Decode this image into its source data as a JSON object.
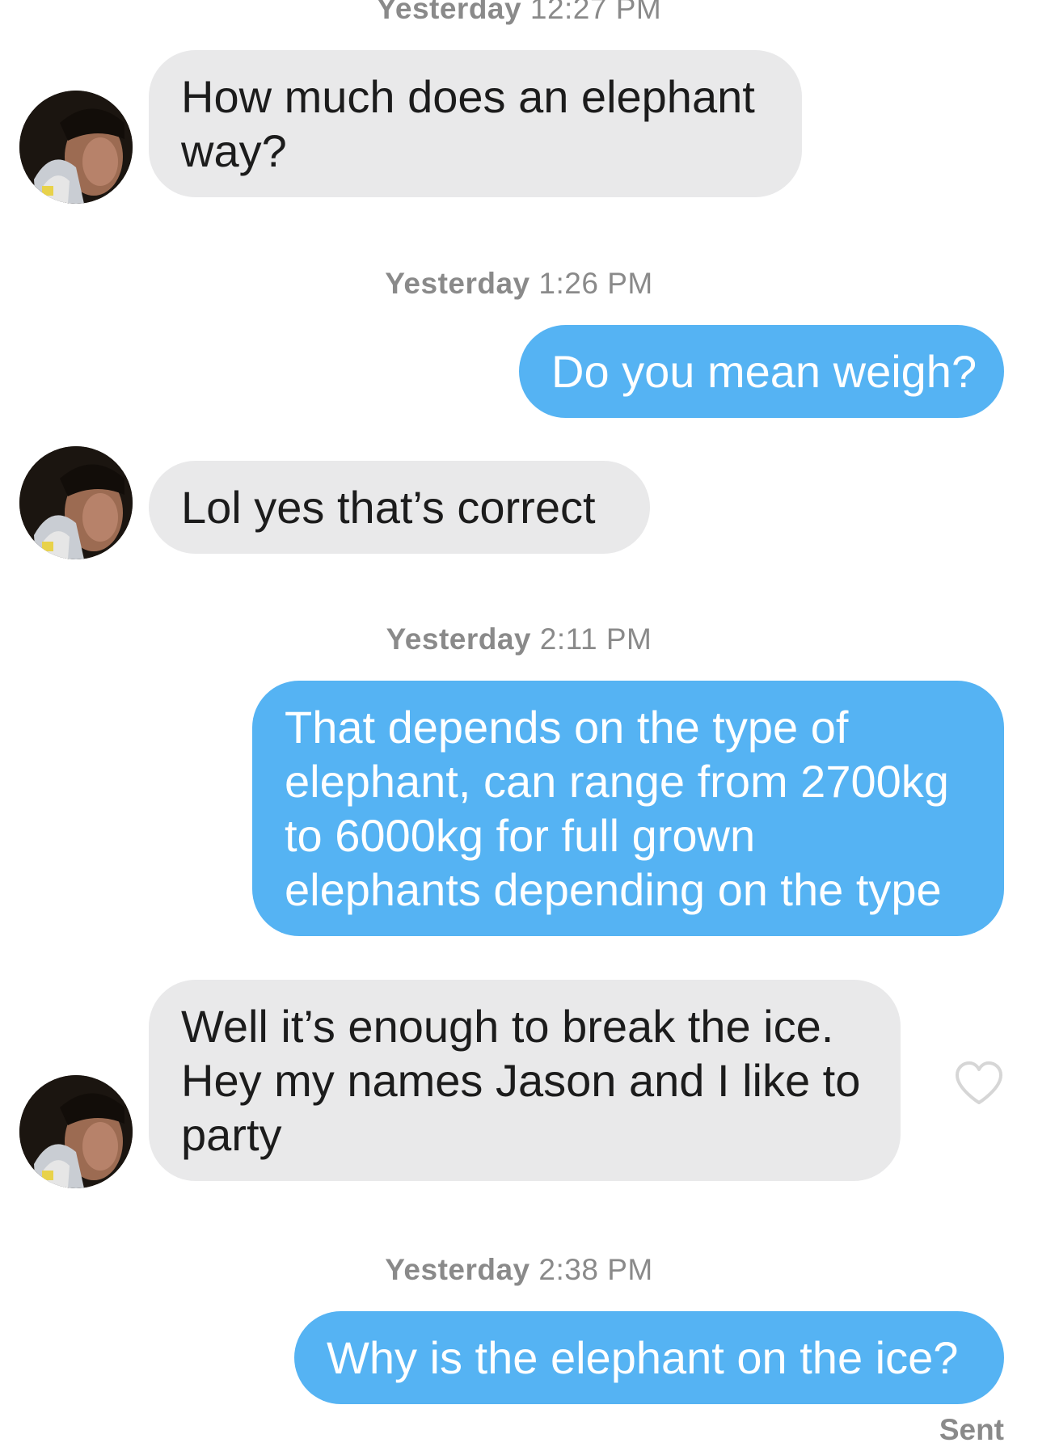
{
  "conversation": {
    "messages": [
      {
        "direction": "incoming",
        "lines": [
          "How much does an elephant",
          "way?"
        ]
      },
      {
        "direction": "outgoing",
        "lines": [
          "Do you mean weigh?"
        ]
      },
      {
        "direction": "incoming",
        "lines": [
          "Lol yes that’s correct"
        ]
      },
      {
        "direction": "outgoing",
        "lines": [
          "That depends on the type of",
          "elephant, can range from 2700kg",
          "to 6000kg for full grown",
          "elephants depending on the type"
        ]
      },
      {
        "direction": "incoming",
        "lines": [
          "Well it’s enough to break the ice.",
          "Hey my names Jason and I like to",
          "party"
        ]
      },
      {
        "direction": "outgoing",
        "lines": [
          "Why is the elephant on the ice?"
        ]
      }
    ],
    "timestamps": [
      {
        "day": "Yesterday",
        "time": "12:27 PM"
      },
      {
        "day": "Yesterday",
        "time": "1:26 PM"
      },
      {
        "day": "Yesterday",
        "time": "2:11 PM"
      },
      {
        "day": "Yesterday",
        "time": "2:38 PM"
      }
    ],
    "delivery_status": "Sent"
  },
  "icons": {
    "avatar": "contact-avatar-photo",
    "like": "heart-outline-icon"
  },
  "colors": {
    "incoming_bubble": "#e9e9ea",
    "outgoing_bubble": "#55b3f3",
    "timestamp_text": "#8a8a8a"
  }
}
